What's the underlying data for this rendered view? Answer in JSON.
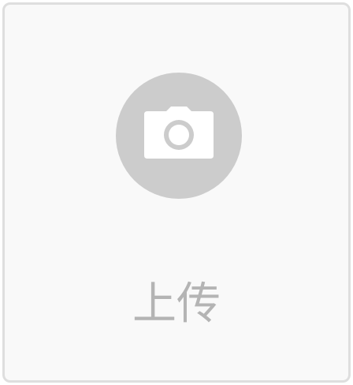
{
  "upload": {
    "label": "上传",
    "icon": "camera-icon"
  },
  "colors": {
    "card_background": "#f9f9f9",
    "card_border": "#dedede",
    "icon_circle": "#cccccc",
    "icon_glyph": "#ffffff",
    "label_text": "#b4b4b4"
  }
}
